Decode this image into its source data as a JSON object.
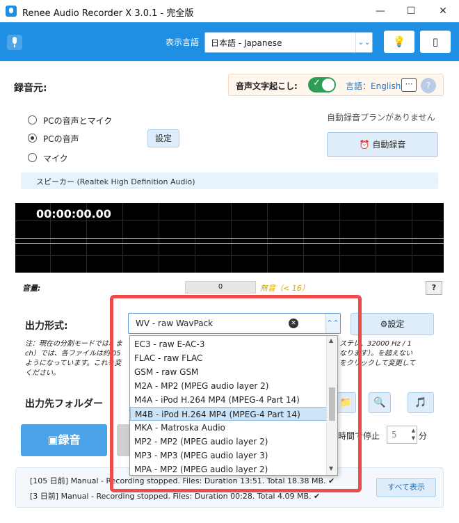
{
  "window": {
    "title": "Renee Audio Recorder X 3.0.1 - 完全版",
    "minimize": "—",
    "maximize": "☐",
    "close": "✕"
  },
  "toolbar": {
    "language_label": "表示言語",
    "language_value": "日本語 - Japanese",
    "language_arrow": "⌄⌄",
    "hint_icon": "💡",
    "tablet_icon": "▯"
  },
  "source": {
    "label": "録音元:",
    "caption": {
      "label": "音声文字起こし:",
      "toggle_check": "✓",
      "language": "言語：English",
      "chat_icon": "⋯",
      "help": "?"
    },
    "options": [
      {
        "label": "PCの音声とマイク",
        "selected": false
      },
      {
        "label": "PCの音声",
        "selected": true
      },
      {
        "label": "マイク",
        "selected": false
      }
    ],
    "settings_button": "設定",
    "no_plan": "自動録音プランがありません",
    "auto_record_button": "⏰ 自動録音",
    "device": "スピーカー (Realtek High Definition Audio)"
  },
  "waveform": {
    "time": "00:00:00.00"
  },
  "volume": {
    "label": "音量:",
    "value": "0",
    "status": "無音（< 16）",
    "help": "?"
  },
  "output": {
    "format_label": "出力形式:",
    "format_value": "WV - raw WavPack",
    "clear": "✕",
    "format_arrow": "⌃⌃",
    "settings_button": "⚙設定",
    "note_left": "注：現在の分割モードでは、ま\nch）では、各ファイルは約 05\nようになっています。これを変\nください。",
    "note_right": "ステレ、32000 Hz / 1\nなります）。を超えない\nをクリックして変更して",
    "folder_label": "出力先フォルダー",
    "folder_icon": "📁",
    "search_icon": "🔍",
    "music_icon": "🎵"
  },
  "formats": [
    "EC3 - raw E-AC-3",
    "FLAC - raw FLAC",
    "GSM - raw GSM",
    "M2A - MP2 (MPEG audio layer 2)",
    "M4A - iPod H.264 MP4 (MPEG-4 Part 14)",
    "M4B - iPod H.264 MP4 (MPEG-4 Part 14)",
    "MKA - Matroska Audio",
    "MP2 - MP2 (MPEG audio layer 2)",
    "MP3 - MP3 (MPEG audio layer 3)",
    "MPA - MP2 (MPEG audio layer 2)"
  ],
  "formats_selected_index": 5,
  "scroll_up": "▲",
  "scroll_down": "▼",
  "record": {
    "button": "▣録音",
    "stop_label": "時間で停止",
    "stop_value": "5",
    "spin_up": "▲",
    "spin_down": "▼",
    "unit": "分"
  },
  "log": {
    "lines": [
      "[105 日前] Manual - Recording stopped. Files: Duration 13:51. Total 18.38 MB. ✔",
      "[3 日前] Manual - Recording stopped. Files: Duration 00:28. Total 4.09 MB. ✔"
    ],
    "show_all": "すべて表示"
  },
  "colors": {
    "accent": "#1e8fe3",
    "toggle_on": "#2e9e57",
    "silent_status": "#e0a300",
    "highlight": "#ee4b4b"
  }
}
